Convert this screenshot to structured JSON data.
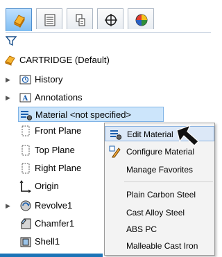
{
  "tabs": [
    {
      "icon": "part-gear-icon",
      "active": true
    },
    {
      "icon": "property-manager-icon",
      "active": false
    },
    {
      "icon": "configuration-manager-icon",
      "active": false
    },
    {
      "icon": "dimxpert-crosshair-icon",
      "active": false
    },
    {
      "icon": "display-manager-icon",
      "active": false
    }
  ],
  "filter_icon": "filter-funnel-icon",
  "tree": {
    "root_label": "CARTRIDGE  (Default)",
    "items": [
      {
        "label": "History",
        "icon": "history-folder-icon",
        "expandable": true
      },
      {
        "label": "Annotations",
        "icon": "annotations-icon",
        "expandable": true
      },
      {
        "label": "Material <not specified>",
        "icon": "material-icon",
        "expandable": false,
        "selected": true
      },
      {
        "label": "Front Plane",
        "icon": "plane-icon",
        "expandable": false
      },
      {
        "label": "Top Plane",
        "icon": "plane-icon",
        "expandable": false
      },
      {
        "label": "Right Plane",
        "icon": "plane-icon",
        "expandable": false
      },
      {
        "label": "Origin",
        "icon": "origin-icon",
        "expandable": false
      },
      {
        "label": "Revolve1",
        "icon": "revolve-icon",
        "expandable": true
      },
      {
        "label": "Chamfer1",
        "icon": "chamfer-icon",
        "expandable": false
      },
      {
        "label": "Shell1",
        "icon": "shell-icon",
        "expandable": false
      }
    ]
  },
  "context_menu": {
    "items": [
      {
        "label": "Edit Material",
        "icon": "material-icon",
        "highlighted": true
      },
      {
        "label": "Configure Material",
        "icon": "configure-pencil-icon"
      },
      {
        "label": "Manage Favorites",
        "icon": ""
      },
      {
        "label": "Plain Carbon Steel",
        "icon": ""
      },
      {
        "label": "Cast Alloy Steel",
        "icon": ""
      },
      {
        "label": "ABS PC",
        "icon": ""
      },
      {
        "label": "Malleable Cast Iron",
        "icon": ""
      }
    ]
  },
  "pointer_icon": "arrow-pointer-icon",
  "colors": {
    "accent": "#1c74b7",
    "selection": "#cce5fb",
    "menu_bg": "#f3f3f3",
    "part_orange": "#f0a020"
  }
}
